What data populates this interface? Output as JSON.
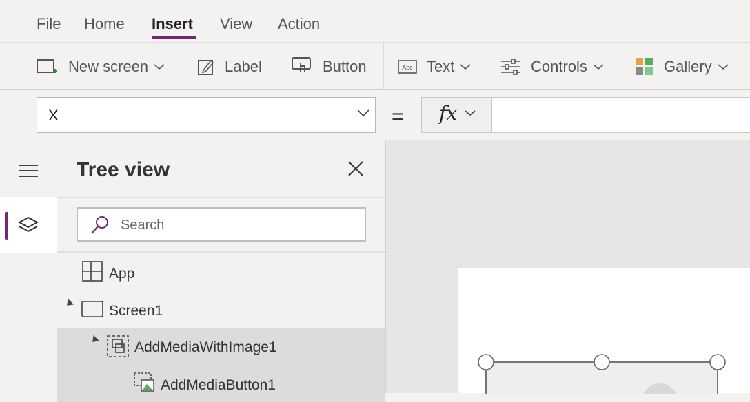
{
  "menu": {
    "items": [
      "File",
      "Home",
      "Insert",
      "View",
      "Action"
    ],
    "active": "Insert"
  },
  "ribbon": {
    "new_screen": "New screen",
    "label": "Label",
    "button": "Button",
    "text": "Text",
    "controls": "Controls",
    "gallery": "Gallery"
  },
  "formula_bar": {
    "property": "X",
    "equals": "=",
    "fx": "fx",
    "formula": ""
  },
  "tree_view": {
    "title": "Tree view",
    "search_placeholder": "Search",
    "items": [
      {
        "label": "App",
        "icon": "app-icon"
      },
      {
        "label": "Screen1",
        "icon": "screen-icon"
      },
      {
        "label": "AddMediaWithImage1",
        "icon": "group-icon"
      },
      {
        "label": "AddMediaButton1",
        "icon": "add-media-icon"
      }
    ]
  },
  "colors": {
    "accent": "#742774",
    "background": "#f3f2f1",
    "canvas": "#e6e6e6",
    "selected_row": "#dcdcdc"
  }
}
